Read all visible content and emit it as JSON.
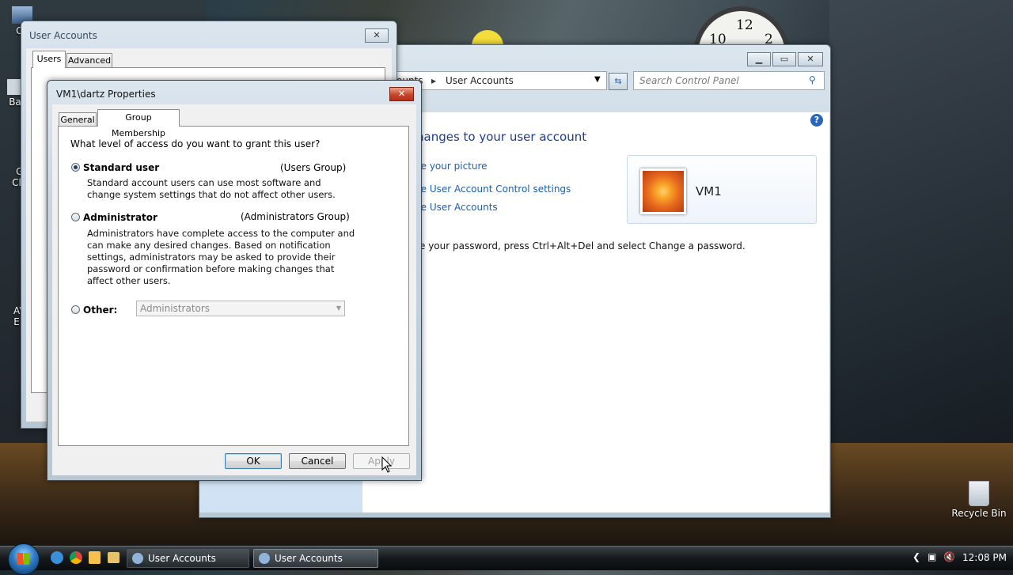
{
  "desktop": {
    "icons": [
      {
        "label": "Co"
      },
      {
        "label": "Ba"
      },
      {
        "label": "G\nCl"
      },
      {
        "label": "AV\nE"
      },
      {
        "label": "Recycle Bin"
      }
    ],
    "clock_numerals": [
      "10",
      "12",
      "2"
    ]
  },
  "user_accounts_bg": {
    "title": "User Accounts",
    "tabs": [
      "Users",
      "Advanced"
    ]
  },
  "control_panel": {
    "breadcrumb_partial": "ounts",
    "breadcrumb_sep": "▸",
    "breadcrumb_current": "User Accounts",
    "search_placeholder": "Search Control Panel",
    "heading": "hanges to your user account",
    "links": [
      "ge your picture",
      "ge User Account Control settings",
      "ge User Accounts"
    ],
    "password_note": "e your password, press Ctrl+Alt+Del and select Change a password.",
    "user_name": "VM1"
  },
  "dialog": {
    "title": "VM1\\dartz Properties",
    "tabs": [
      "General",
      "Group Membership"
    ],
    "question": "What level of access do you want to grant this user?",
    "standard": {
      "label": "Standard user",
      "group": "(Users Group)",
      "description": "Standard account users can use most software and change system settings that do not affect other users.",
      "selected": true
    },
    "admin": {
      "label": "Administrator",
      "group": "(Administrators Group)",
      "description": "Administrators have complete access to the computer and can make any desired changes. Based on notification settings, administrators may be asked to provide their password or confirmation before making changes that affect other users.",
      "selected": false
    },
    "other": {
      "label": "Other:",
      "value": "Administrators",
      "selected": false
    },
    "buttons": {
      "ok": "OK",
      "cancel": "Cancel",
      "apply": "Apply"
    }
  },
  "taskbar": {
    "tasks": [
      "User Accounts",
      "User Accounts"
    ],
    "time": "12:08 PM"
  },
  "colors": {
    "link": "#1a5fb4",
    "heading": "#1e3d8c",
    "close_button": "#c8452b"
  }
}
